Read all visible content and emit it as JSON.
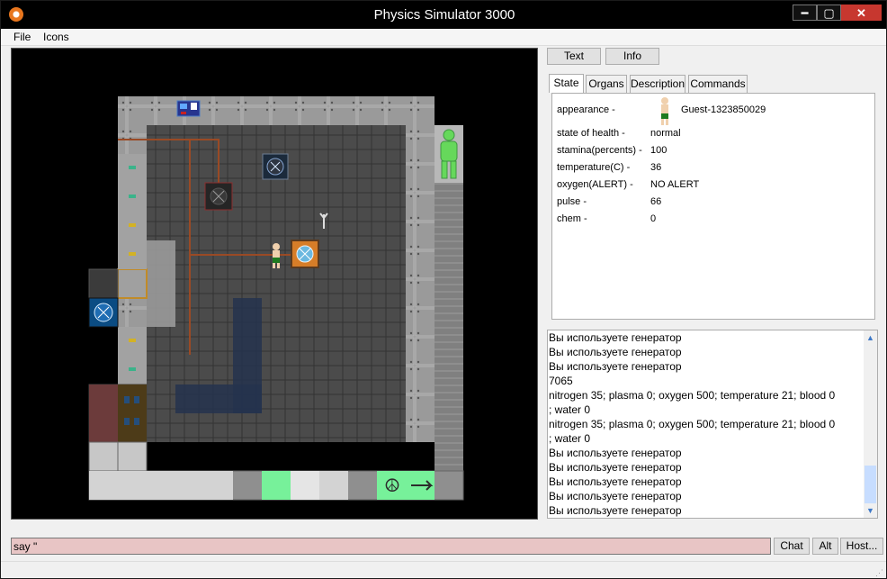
{
  "window": {
    "title": "Physics Simulator 3000",
    "minimize_label": "━",
    "maximize_label": "▢",
    "close_label": "✕"
  },
  "menu": {
    "file": "File",
    "icons": "Icons"
  },
  "right_panel": {
    "text_button": "Text",
    "info_button": "Info",
    "tabs": [
      "State",
      "Organs",
      "Description",
      "Commands"
    ],
    "state": {
      "appearance_label": "appearance -",
      "appearance_value": "Guest-1323850029",
      "rows": [
        {
          "label": "state of health -",
          "value": "normal"
        },
        {
          "label": "stamina(percents) -",
          "value": "100"
        },
        {
          "label": "temperature(C) -",
          "value": "36"
        },
        {
          "label": "oxygen(ALERT) -",
          "value": "NO ALERT"
        },
        {
          "label": "pulse -",
          "value": "66"
        },
        {
          "label": "chem -",
          "value": "0"
        }
      ]
    }
  },
  "log": {
    "lines": [
      "Вы используете генератор",
      "Вы используете генератор",
      "Вы используете генератор",
      "7065",
      "nitrogen 35; plasma 0; oxygen 500; temperature 21; blood 0",
      "; water 0",
      "nitrogen 35; plasma 0; oxygen 500; temperature 21; blood 0",
      "; water 0",
      "Вы используете генератор",
      "Вы используете генератор",
      "Вы используете генератор",
      "Вы используете генератор",
      "Вы используете генератор"
    ]
  },
  "input": {
    "say_value": "say \""
  },
  "bottom_buttons": {
    "chat": "Chat",
    "alt": "Alt",
    "host": "Host..."
  },
  "colors": {
    "floor": "#4b4b4b",
    "wall": "#9a9a9a",
    "accent_green": "#77f19a",
    "pipe": "#9a4a25"
  }
}
